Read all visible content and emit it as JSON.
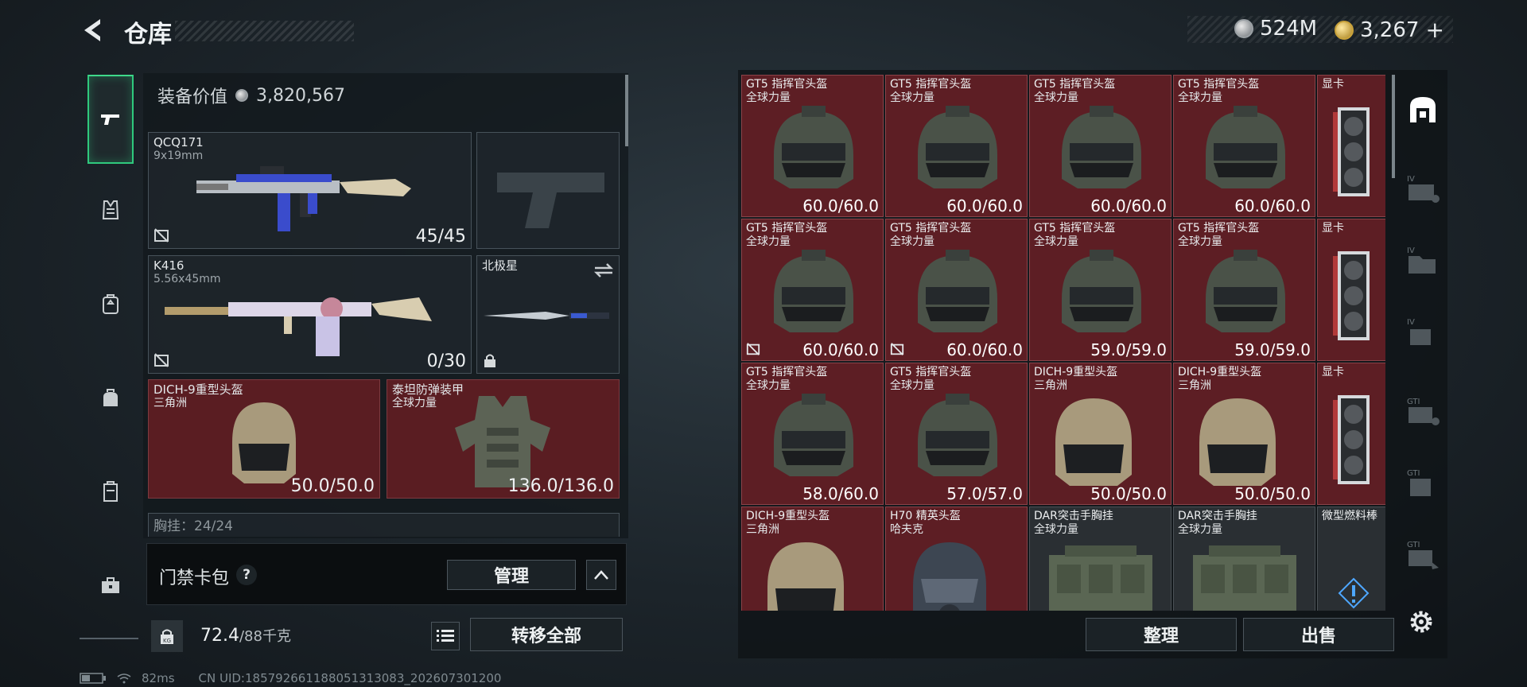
{
  "header": {
    "title": "仓库",
    "silver_amount": "524M",
    "gold_amount": "3,267",
    "gold_plus": "+"
  },
  "equipment": {
    "value_label": "装备价值",
    "value": "3,820,567",
    "primary": {
      "name": "QCQ171",
      "caliber": "9x19mm",
      "ammo": "45/45"
    },
    "secondary": {
      "name": "K416",
      "caliber": "5.56x45mm",
      "ammo": "0/30"
    },
    "melee": {
      "name": "北极星"
    },
    "helmet": {
      "name": "DICH-9重型头盔",
      "origin": "三角洲",
      "durability": "50.0/50.0"
    },
    "armor": {
      "name": "泰坦防弹装甲",
      "origin": "全球力量",
      "durability": "136.0/136.0"
    },
    "chest_rig": {
      "label": "胸挂",
      "value": "24/24"
    }
  },
  "keycard": {
    "label": "门禁卡包",
    "help": "?",
    "manage_button": "管理"
  },
  "capacity": {
    "current": "72.4",
    "max": "/88千克",
    "transfer_all_button": "转移全部"
  },
  "status_bar": {
    "ping": "82ms",
    "uid": "CN UID:185792661188051313083_202607301200"
  },
  "storage": {
    "sort_button": "整理",
    "sell_button": "出售",
    "rows": [
      [
        {
          "name": "GT5 指挥官头盔",
          "origin": "全球力量",
          "durability": "60.0/60.0",
          "locked": false
        },
        {
          "name": "GT5 指挥官头盔",
          "origin": "全球力量",
          "durability": "60.0/60.0",
          "locked": false
        },
        {
          "name": "GT5 指挥官头盔",
          "origin": "全球力量",
          "durability": "60.0/60.0",
          "locked": false
        },
        {
          "name": "GT5 指挥官头盔",
          "origin": "全球力量",
          "durability": "60.0/60.0",
          "locked": false
        },
        {
          "name": "显卡",
          "origin": "",
          "durability": "",
          "locked": false
        }
      ],
      [
        {
          "name": "GT5 指挥官头盔",
          "origin": "全球力量",
          "durability": "60.0/60.0",
          "locked": true
        },
        {
          "name": "GT5 指挥官头盔",
          "origin": "全球力量",
          "durability": "60.0/60.0",
          "locked": true
        },
        {
          "name": "GT5 指挥官头盔",
          "origin": "全球力量",
          "durability": "59.0/59.0",
          "locked": false
        },
        {
          "name": "GT5 指挥官头盔",
          "origin": "全球力量",
          "durability": "59.0/59.0",
          "locked": false
        },
        {
          "name": "显卡",
          "origin": "",
          "durability": "",
          "locked": false
        }
      ],
      [
        {
          "name": "GT5 指挥官头盔",
          "origin": "全球力量",
          "durability": "58.0/60.0",
          "locked": false
        },
        {
          "name": "GT5 指挥官头盔",
          "origin": "全球力量",
          "durability": "57.0/57.0",
          "locked": false
        },
        {
          "name": "DICH-9重型头盔",
          "origin": "三角洲",
          "durability": "50.0/50.0",
          "locked": false
        },
        {
          "name": "DICH-9重型头盔",
          "origin": "三角洲",
          "durability": "50.0/50.0",
          "locked": false
        },
        {
          "name": "显卡",
          "origin": "",
          "durability": "",
          "locked": false
        }
      ],
      [
        {
          "name": "DICH-9重型头盔",
          "origin": "三角洲",
          "durability": "",
          "locked": false
        },
        {
          "name": "H70 精英头盔",
          "origin": "哈夫克",
          "durability": "",
          "locked": false
        },
        {
          "name": "DAR突击手胸挂",
          "origin": "全球力量",
          "durability": "",
          "locked": false
        },
        {
          "name": "DAR突击手胸挂",
          "origin": "全球力量",
          "durability": "",
          "locked": false
        },
        {
          "name": "微型燃料棒",
          "origin": "",
          "durability": "",
          "locked": false
        }
      ]
    ]
  },
  "colors": {
    "accent_green": "#2fc97d",
    "item_red_bg": "#5d1e24",
    "panel_dark": "#12181c"
  },
  "icons": {
    "nav": [
      "pistol-icon",
      "vest-icon",
      "backpack-icon",
      "bag-icon",
      "case-icon",
      "toolbox-icon"
    ],
    "right_nav": [
      "storage-icon",
      "storage-tab-4-icon",
      "storage-tab-4b-icon",
      "storage-tab-4c-icon",
      "storage-tab-gt-icon",
      "storage-tab-gtb-icon",
      "storage-tab-gtc-icon",
      "gear-icon"
    ]
  }
}
